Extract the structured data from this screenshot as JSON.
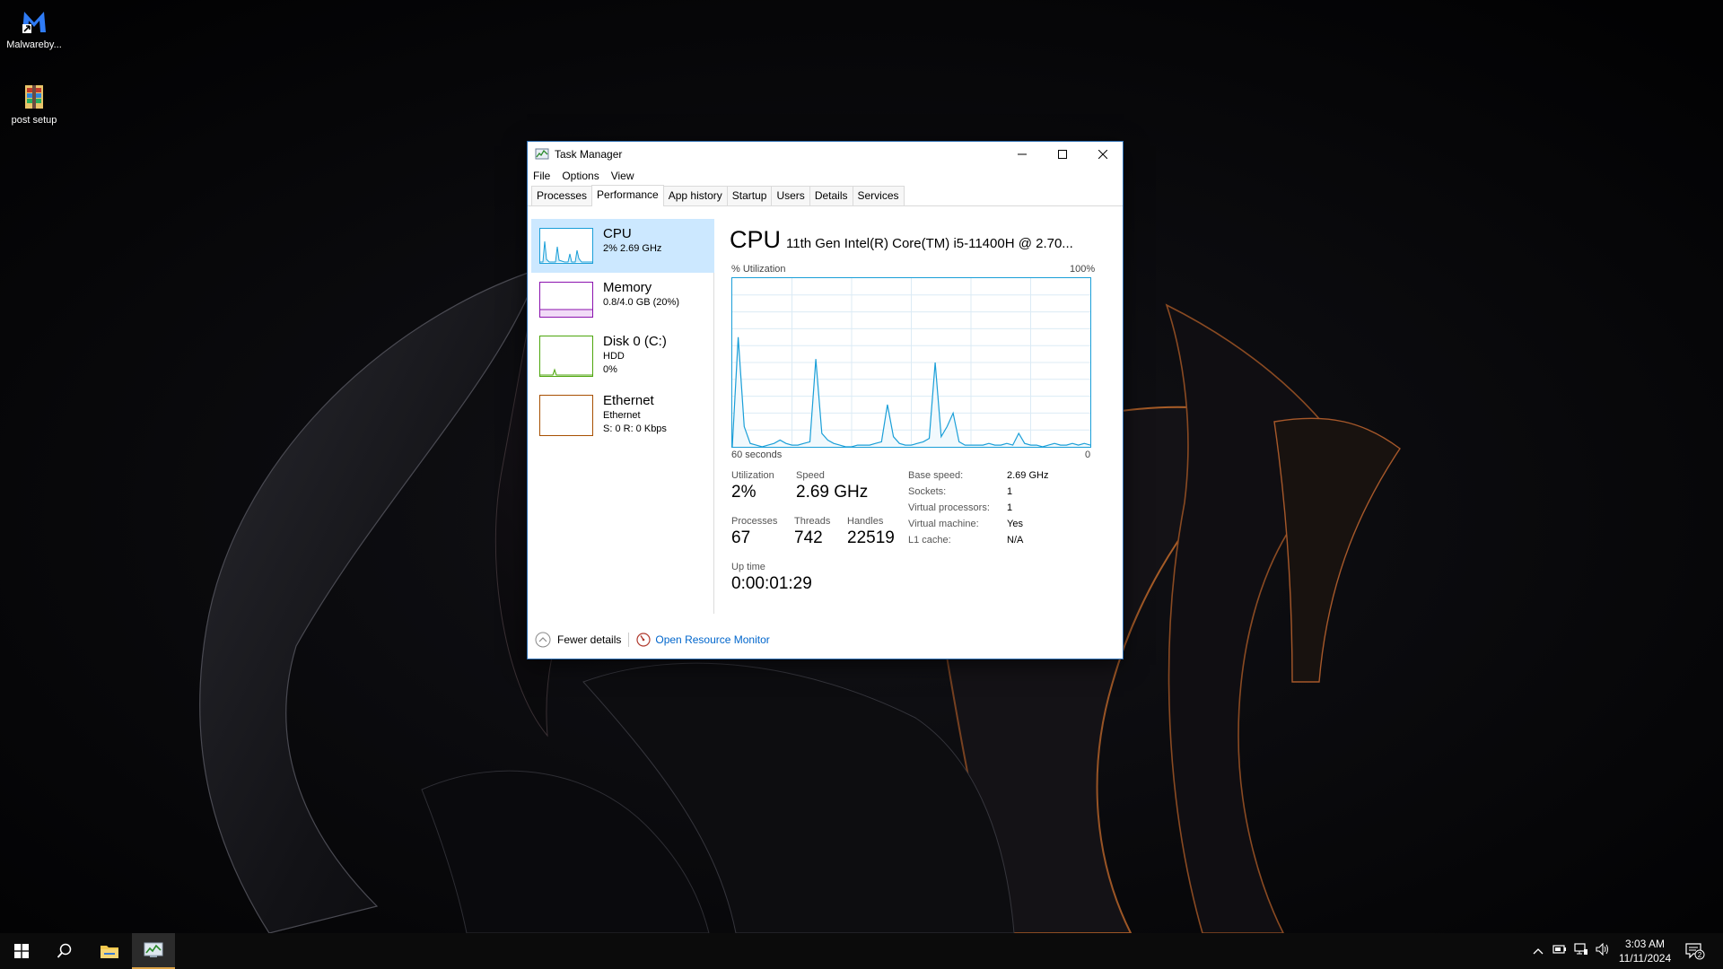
{
  "desktop": {
    "icons": [
      {
        "label": "Malwareby...",
        "icon": "malwarebytes-icon"
      },
      {
        "label": "post setup",
        "icon": "archive-icon"
      }
    ]
  },
  "window": {
    "title": "Task Manager",
    "menu": [
      "File",
      "Options",
      "View"
    ],
    "tabs": [
      "Processes",
      "Performance",
      "App history",
      "Startup",
      "Users",
      "Details",
      "Services"
    ],
    "active_tab": "Performance"
  },
  "resources": [
    {
      "name": "CPU",
      "line1": "2% 2.69 GHz",
      "line2": "",
      "color": "#1a9fd8"
    },
    {
      "name": "Memory",
      "line1": "0.8/4.0 GB (20%)",
      "line2": "",
      "color": "#8b12ae"
    },
    {
      "name": "Disk 0 (C:)",
      "line1": "HDD",
      "line2": "0%",
      "color": "#4da60c"
    },
    {
      "name": "Ethernet",
      "line1": "Ethernet",
      "line2": "S: 0 R: 0 Kbps",
      "color": "#a74f01"
    }
  ],
  "cpu": {
    "title": "CPU",
    "model": "11th Gen Intel(R) Core(TM) i5-11400H @ 2.70...",
    "utilization_label": "% Utilization",
    "max_label": "100%",
    "time_label": "60 seconds",
    "min_label": "0",
    "stats": {
      "utilization_label": "Utilization",
      "utilization": "2%",
      "speed_label": "Speed",
      "speed": "2.69 GHz",
      "processes_label": "Processes",
      "processes": "67",
      "threads_label": "Threads",
      "threads": "742",
      "handles_label": "Handles",
      "handles": "22519",
      "uptime_label": "Up time",
      "uptime": "0:00:01:29"
    },
    "details": [
      {
        "k": "Base speed:",
        "v": "2.69 GHz"
      },
      {
        "k": "Sockets:",
        "v": "1"
      },
      {
        "k": "Virtual processors:",
        "v": "1"
      },
      {
        "k": "Virtual machine:",
        "v": "Yes"
      },
      {
        "k": "L1 cache:",
        "v": "N/A"
      }
    ]
  },
  "chart_data": {
    "type": "area",
    "x": [
      60,
      59,
      58,
      57,
      56,
      55,
      54,
      53,
      52,
      51,
      50,
      49,
      48,
      47,
      46,
      45,
      44,
      43,
      42,
      41,
      40,
      39,
      38,
      37,
      36,
      35,
      34,
      33,
      32,
      31,
      30,
      29,
      28,
      27,
      26,
      25,
      24,
      23,
      22,
      21,
      20,
      19,
      18,
      17,
      16,
      15,
      14,
      13,
      12,
      11,
      10,
      9,
      8,
      7,
      6,
      5,
      4,
      3,
      2,
      1,
      0
    ],
    "series": [
      {
        "values": [
          0,
          65,
          12,
          2,
          1,
          0,
          1,
          2,
          4,
          2,
          1,
          1,
          2,
          3,
          52,
          8,
          4,
          2,
          1,
          0,
          0,
          1,
          1,
          1,
          2,
          3,
          25,
          6,
          2,
          1,
          1,
          2,
          3,
          5,
          50,
          6,
          12,
          20,
          3,
          1,
          1,
          1,
          1,
          2,
          1,
          1,
          2,
          1,
          8,
          2,
          1,
          1,
          0,
          1,
          2,
          1,
          1,
          2,
          1,
          2,
          1
        ]
      }
    ],
    "ylim": [
      0,
      100
    ],
    "xlabel": "60 seconds",
    "ylabel": "% Utilization",
    "grid": true
  },
  "footer": {
    "fewer_details": "Fewer details",
    "open_resource_monitor": "Open Resource Monitor"
  },
  "taskbar": {
    "time": "3:03 AM",
    "date": "11/11/2024",
    "notifications": "2"
  }
}
